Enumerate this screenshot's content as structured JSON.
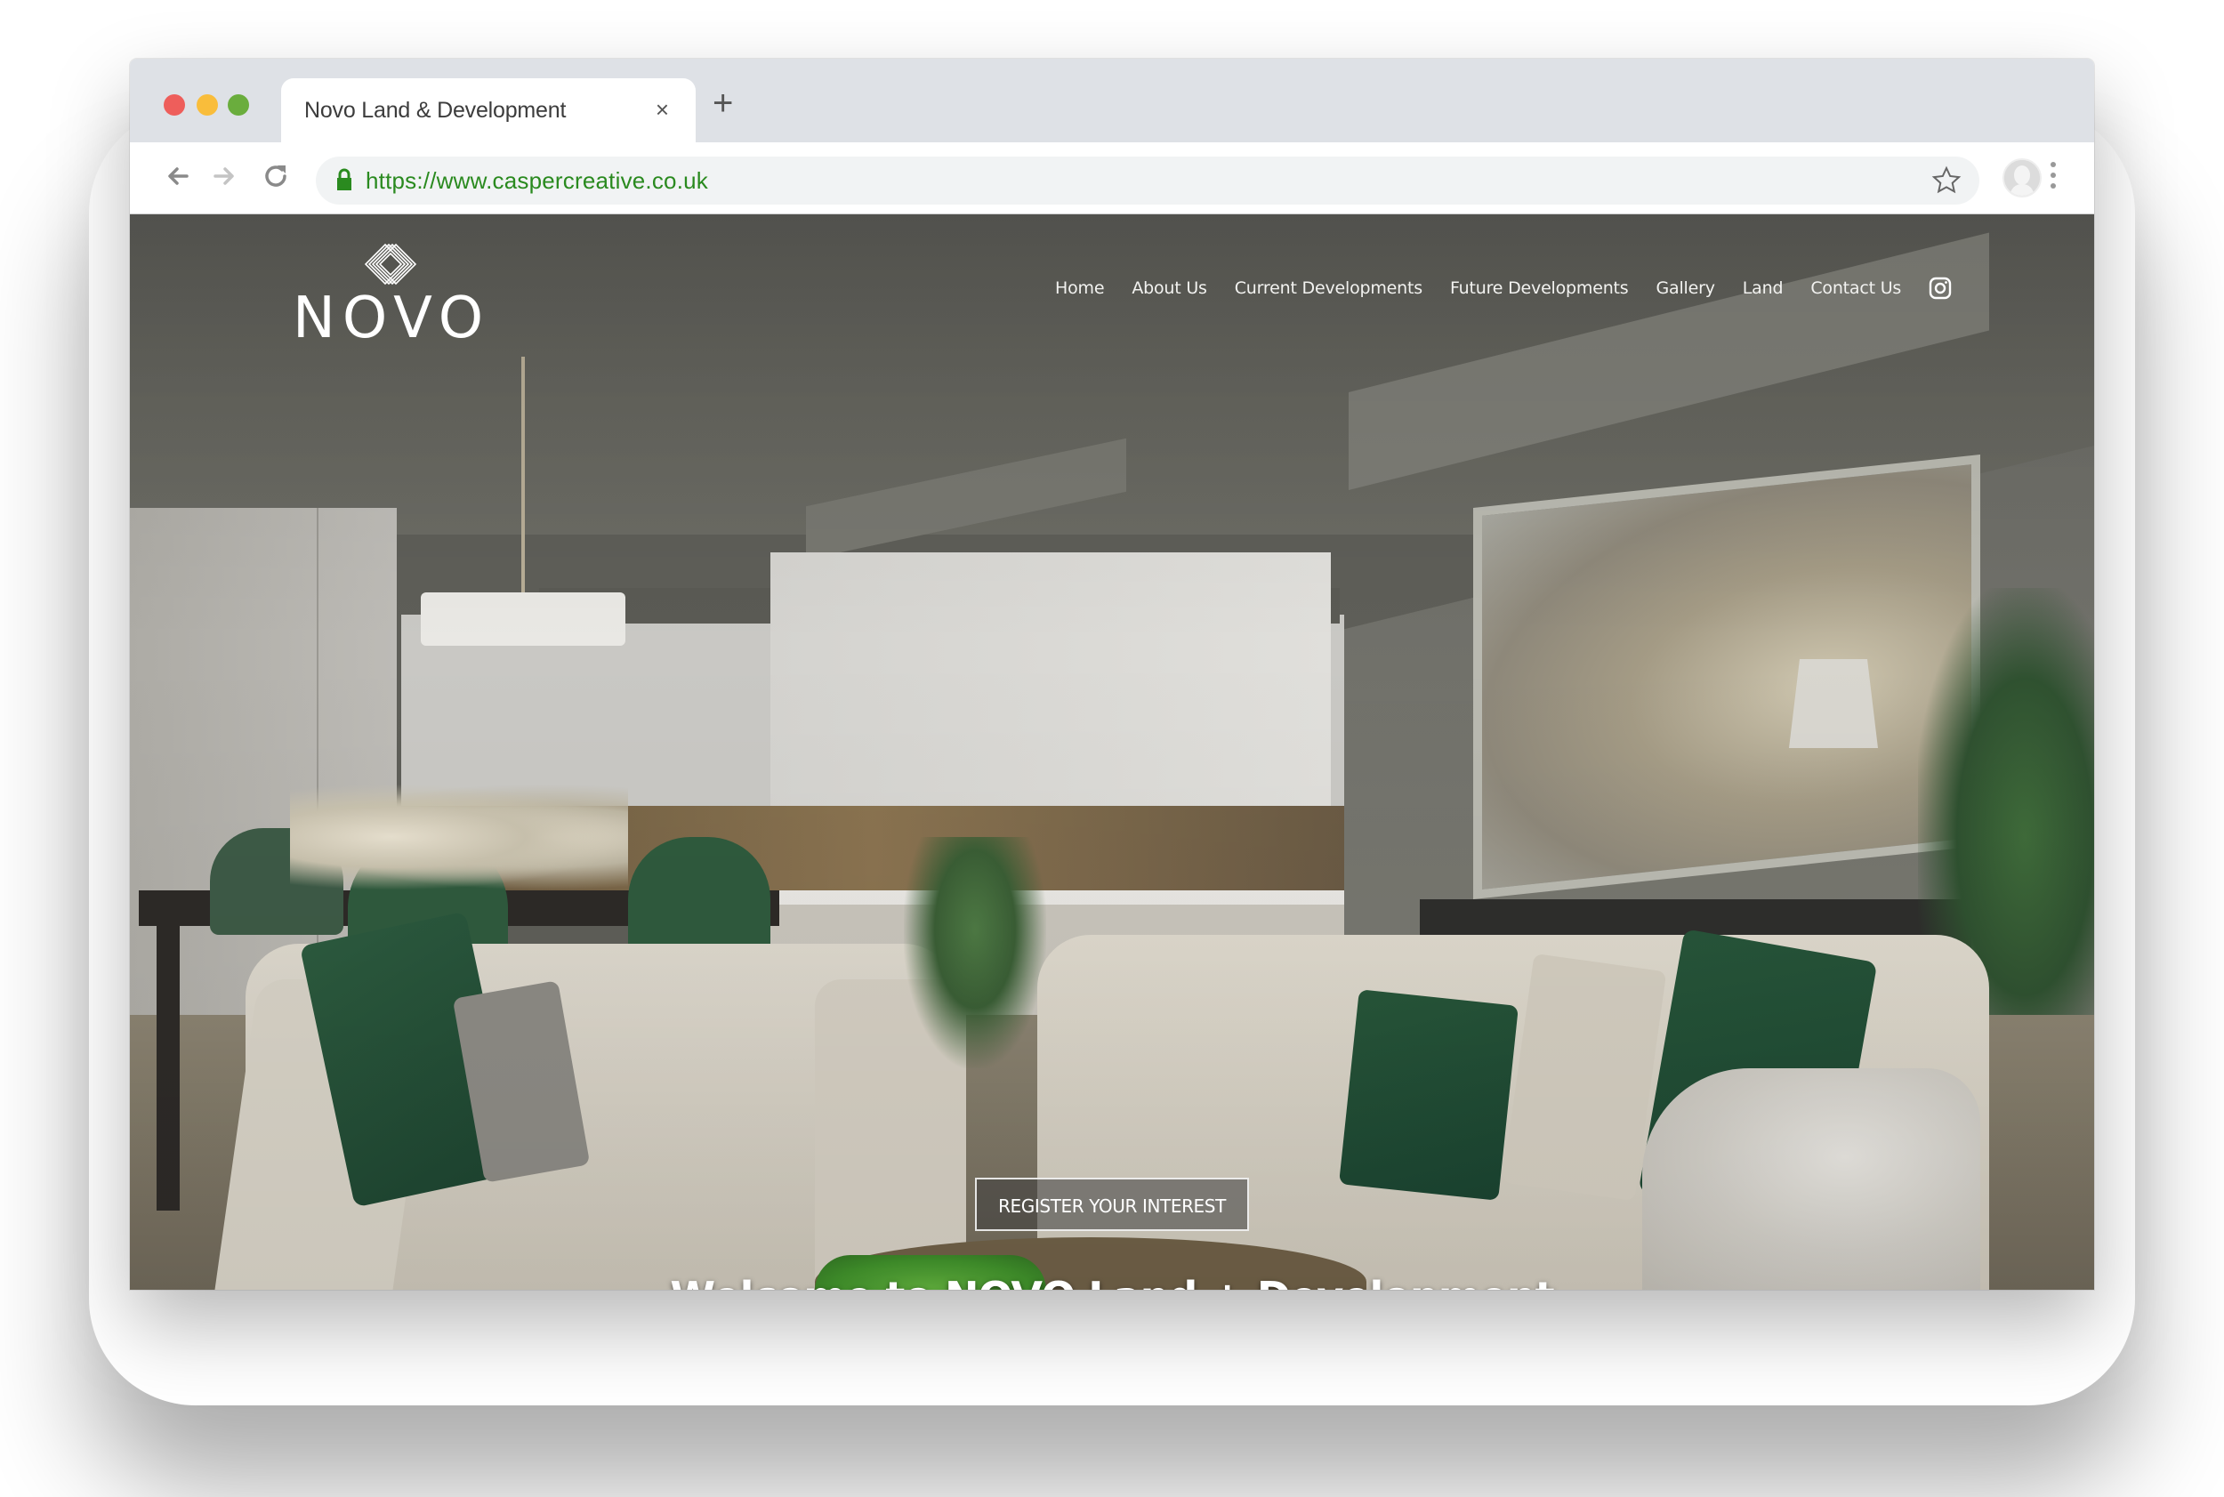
{
  "browser": {
    "window_controls": [
      "close",
      "minimize",
      "maximize"
    ],
    "tab": {
      "title": "Novo Land & Development",
      "close_label": "×"
    },
    "new_tab_label": "+",
    "url": "https://www.caspercreative.co.uk",
    "icons": [
      "back-arrow-icon",
      "forward-arrow-icon",
      "reload-icon",
      "lock-icon",
      "bookmark-star-icon",
      "profile-avatar-icon",
      "more-menu-icon"
    ],
    "colors": {
      "url_green": "#2a8a1f",
      "tabstrip": "#dee1e6",
      "omnibox": "#f1f3f4"
    }
  },
  "site": {
    "logo": {
      "text": "NOVO",
      "mark": "nested-diamond-logo-icon"
    },
    "nav": {
      "items": [
        {
          "label": "Home"
        },
        {
          "label": "About Us"
        },
        {
          "label": "Current Developments"
        },
        {
          "label": "Future Developments"
        },
        {
          "label": "Gallery"
        },
        {
          "label": "Land"
        },
        {
          "label": "Contact Us"
        }
      ],
      "social_icon": "instagram-icon"
    },
    "hero": {
      "image_description": "Modern open-plan kitchen and living room with cream sofas and dark green cushions",
      "cta_label": "REGISTER YOUR INTEREST",
      "headline": "Welcome to NOVO Land + Development"
    }
  }
}
